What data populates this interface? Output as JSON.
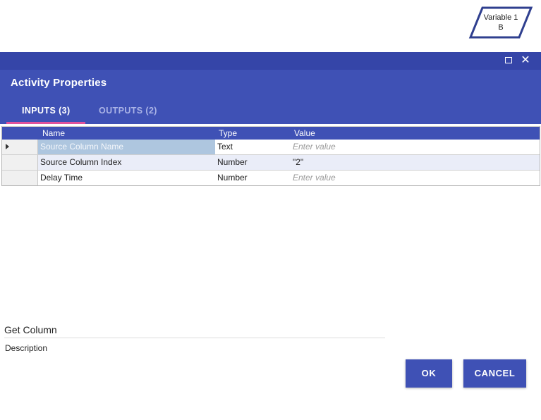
{
  "flow_node": {
    "line1": "Variable 1",
    "line2": "B"
  },
  "window": {
    "maximize_icon": "maximize-icon",
    "close_icon": "close-icon",
    "close_glyph": "✕"
  },
  "dialog": {
    "title": "Activity Properties",
    "tabs": [
      {
        "label": "INPUTS (3)",
        "active": true
      },
      {
        "label": "OUTPUTS (2)",
        "active": false
      }
    ]
  },
  "grid": {
    "columns": [
      "Name",
      "Type",
      "Value"
    ],
    "rows": [
      {
        "name": "Source Column Name",
        "type": "Text",
        "value": "",
        "placeholder": "Enter value",
        "selected": true
      },
      {
        "name": "Source Column Index",
        "type": "Number",
        "value": "\"2\"",
        "placeholder": "",
        "selected": false
      },
      {
        "name": "Delay Time",
        "type": "Number",
        "value": "",
        "placeholder": "Enter value",
        "selected": false
      }
    ]
  },
  "activity": {
    "name": "Get Column",
    "description": "Description"
  },
  "buttons": {
    "ok": "OK",
    "cancel": "CANCEL"
  },
  "colors": {
    "primary": "#3f51b5",
    "window_bar": "#3545a8",
    "tab_indicator": "#e0529c",
    "selected_cell": "#aec6df"
  }
}
